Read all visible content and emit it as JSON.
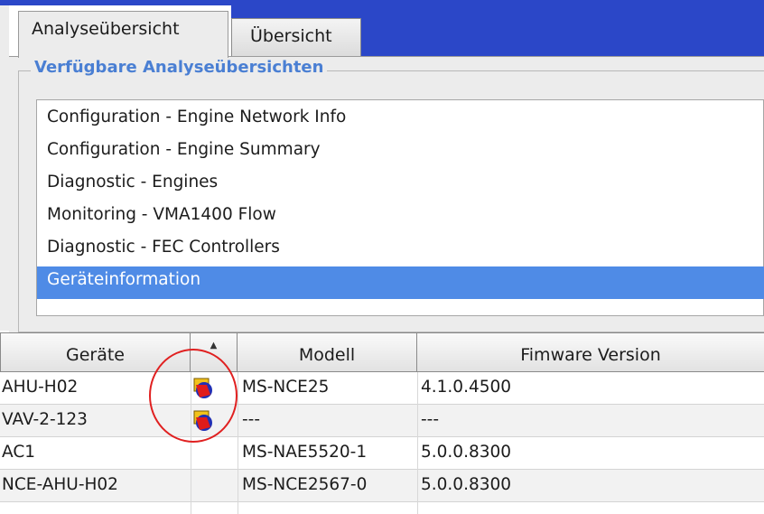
{
  "tabs": [
    {
      "label": "Analyseübersicht",
      "active": true
    },
    {
      "label": "Übersicht",
      "active": false
    }
  ],
  "group_title": "Verfügbare Analyseübersichten",
  "list_items": [
    "Configuration - Engine Network Info",
    "Configuration - Engine Summary",
    "Diagnostic - Engines",
    "Monitoring - VMA1400 Flow",
    "Diagnostic - FEC Controllers",
    "Geräteinformation"
  ],
  "selected_index": 5,
  "table": {
    "columns": [
      "Geräte",
      "",
      "Modell",
      "Fimware Version"
    ],
    "rows": [
      {
        "device": "AHU-H02",
        "icon": "device-alarm-icon",
        "model": "MS-NCE25",
        "firmware": "4.1.0.4500"
      },
      {
        "device": "VAV-2-123",
        "icon": "device-alarm-icon",
        "model": "---",
        "firmware": "---"
      },
      {
        "device": "AC1",
        "icon": "",
        "model": "MS-NAE5520-1",
        "firmware": "5.0.0.8300"
      },
      {
        "device": "NCE-AHU-H02",
        "icon": "",
        "model": "MS-NCE2567-0",
        "firmware": "5.0.0.8300"
      }
    ]
  },
  "colors": {
    "accent": "#2b47c8",
    "selection": "#4f8be6",
    "group_title": "#4a7fd3",
    "highlight": "#e02020"
  }
}
